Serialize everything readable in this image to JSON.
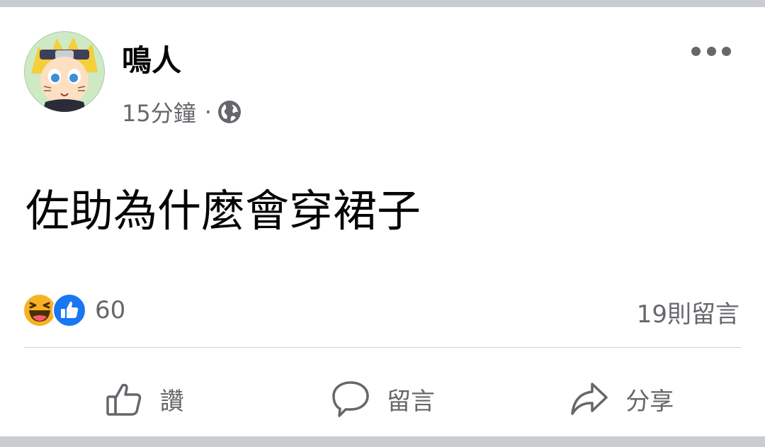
{
  "post": {
    "author": "鳴人",
    "time": "15分鐘",
    "separator": "·",
    "privacy_icon": "globe-icon",
    "more_icon": "more-horizontal-icon",
    "text": "佐助為什麼會穿裙子"
  },
  "reactions": {
    "icons": [
      "haha-icon",
      "like-icon"
    ],
    "count": "60",
    "comments_count": "19則留言"
  },
  "actions": {
    "like_label": "讚",
    "comment_label": "留言",
    "share_label": "分享"
  },
  "colors": {
    "text_primary": "#050505",
    "text_secondary": "#65676b",
    "like_blue": "#1877f2",
    "haha_yellow": "#f7b125",
    "divider": "#ced0d4",
    "background": "#c9ccd1"
  }
}
